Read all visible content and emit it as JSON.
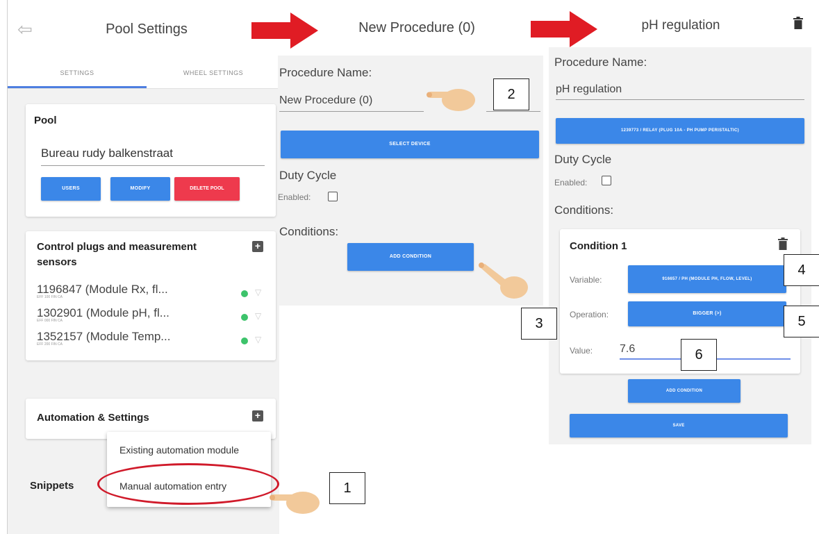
{
  "panel1": {
    "title": "Pool Settings",
    "tabs": [
      "SETTINGS",
      "WHEEL SETTINGS"
    ],
    "pool_card": {
      "title": "Pool",
      "pool_name": "Bureau rudy balkenstraat",
      "buttons": {
        "users": "USERS",
        "modify": "MODIFY",
        "delete": "DELETE POOL"
      }
    },
    "plugs_card": {
      "title_line1": "Control plugs and measurement",
      "title_line2": "sensors",
      "items": [
        {
          "name": "1196847 (Module Rx, fl...",
          "sub": "EFF 100 FIN CA"
        },
        {
          "name": "1302901 (Module pH, fl...",
          "sub": "EFF 000 FIN CA"
        },
        {
          "name": "1352157 (Module Temp...",
          "sub": "EFF 200 FIN CA"
        }
      ]
    },
    "automation_card": {
      "title": "Automation & Settings"
    },
    "menu": {
      "item1": "Existing automation module",
      "item2": "Manual automation entry"
    },
    "snippets": "Snippets"
  },
  "panel2": {
    "title": "New Procedure (0)",
    "procedure_name_label": "Procedure Name:",
    "procedure_name_value": "New Procedure (0)",
    "select_device_button": "SELECT DEVICE",
    "duty_cycle_label": "Duty Cycle",
    "enabled_label": "Enabled:",
    "conditions_label": "Conditions:",
    "add_condition_button": "ADD CONDITION"
  },
  "panel3": {
    "title": "pH regulation",
    "procedure_name_label": "Procedure Name:",
    "procedure_name_value": "pH regulation",
    "device_button": "1239773 / RELAY (PLUG 10A - PH PUMP PERISTALTIC)",
    "duty_cycle_label": "Duty Cycle",
    "enabled_label": "Enabled:",
    "conditions_label": "Conditions:",
    "condition": {
      "title": "Condition 1",
      "variable_label": "Variable:",
      "variable_value": "916657 / PH (MODULE PH, FLOW, LEVEL)",
      "operation_label": "Operation:",
      "operation_value": "BIGGER (>)",
      "value_label": "Value:",
      "value": "7.6"
    },
    "add_condition_button": "ADD CONDITION",
    "save_button": "SAVE"
  },
  "annotations": {
    "n1": "1",
    "n2": "2",
    "n3": "3",
    "n4": "4",
    "n5": "5",
    "n6": "6"
  },
  "colors": {
    "accent_blue": "#3b87e8",
    "danger_red": "#ee3a4d",
    "arrow_red": "#e01c24",
    "status_green": "#3dc36b"
  }
}
